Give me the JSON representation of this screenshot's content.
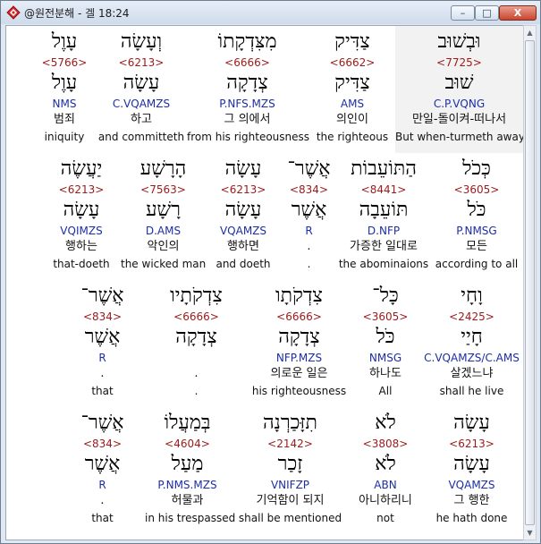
{
  "window": {
    "title": "@원전분해 - 겔 18:24",
    "buttons": {
      "minimize": "–",
      "maximize": "□",
      "close": "X"
    }
  },
  "rows": [
    {
      "cells": [
        {
          "hebrew": "וּבְשׁוּב",
          "strong": "<7725>",
          "lemma": "שׁוּב",
          "parse": "C.P.VQNG",
          "korean": "만일-돌이켜-떠나서",
          "english": "But when-turmeth away",
          "selected": true
        },
        {
          "hebrew": "צַדִּיק",
          "strong": "<6662>",
          "lemma": "צַדִּיק",
          "parse": "AMS",
          "korean": "의인이",
          "english": "the righteous",
          "selected": false
        },
        {
          "hebrew": "מִצִּדְקָתוֹ",
          "strong": "<6666>",
          "lemma": "צְדָקָה",
          "parse": "P.NFS.MZS",
          "korean": "그 의에서",
          "english": "from his righteousness",
          "selected": false
        },
        {
          "hebrew": "וְעָשָׂה",
          "strong": "<6213>",
          "lemma": "עָשָׂה",
          "parse": "C.VQAMZS",
          "korean": "하고",
          "english": "and committeth",
          "selected": false
        },
        {
          "hebrew": "עָוֶל",
          "strong": "<5766>",
          "lemma": "עָוֶל",
          "parse": "NMS",
          "korean": "범죄",
          "english": "iniquity",
          "selected": false
        }
      ]
    },
    {
      "cells": [
        {
          "hebrew": "כְּכֹל",
          "strong": "<3605>",
          "lemma": "כֹּל",
          "parse": "P.NMSG",
          "korean": "모든",
          "english": "according to all",
          "selected": false
        },
        {
          "hebrew": "הַתּוֹעֵבוֹת",
          "strong": "<8441>",
          "lemma": "תּוֹעֵבָה",
          "parse": "D.NFP",
          "korean": "가증한 일대로",
          "english": "the abominaions",
          "selected": false
        },
        {
          "hebrew": "אֲשֶׁר־",
          "strong": "<834>",
          "lemma": "אֲשֶׁר",
          "parse": "R",
          "korean": ".",
          "english": ".",
          "selected": false
        },
        {
          "hebrew": "עָשָׂה",
          "strong": "<6213>",
          "lemma": "עָשָׂה",
          "parse": "VQAMZS",
          "korean": "행하면",
          "english": "and doeth",
          "selected": false
        },
        {
          "hebrew": "הָרָשָׁע",
          "strong": "<7563>",
          "lemma": "רָשָׁע",
          "parse": "D.AMS",
          "korean": "악인의",
          "english": "the wicked man",
          "selected": false
        },
        {
          "hebrew": "יַעֲשֶׂה",
          "strong": "<6213>",
          "lemma": "עָשָׂה",
          "parse": "VQIMZS",
          "korean": "행하는",
          "english": "that-doeth",
          "selected": false
        }
      ]
    },
    {
      "cells": [
        {
          "hebrew": "וָחָי",
          "strong": "<2425>",
          "lemma": "חָיַי",
          "parse": "C.VQAMZS/C.AMS",
          "korean": "살겠느냐",
          "english": "shall he live",
          "selected": false
        },
        {
          "hebrew": "כָּל־",
          "strong": "<3605>",
          "lemma": "כֹּל",
          "parse": "NMSG",
          "korean": "하나도",
          "english": "All",
          "selected": false
        },
        {
          "hebrew": "צִדְקֹתָו",
          "strong": "<6666>",
          "lemma": "צְדָקָה",
          "parse": "NFP.MZS",
          "korean": "의로운 일은",
          "english": "his righteousness",
          "selected": false
        },
        {
          "hebrew": "צִדְקֹתָיו",
          "strong": "<6666>",
          "lemma": "צְדָקָה",
          "parse": "",
          "korean": ".",
          "english": ".",
          "selected": false
        },
        {
          "hebrew": "אֲשֶׁר־",
          "strong": "<834>",
          "lemma": "אֲשֶׁר",
          "parse": "R",
          "korean": ".",
          "english": "that",
          "selected": false
        }
      ]
    },
    {
      "cells": [
        {
          "hebrew": "עָשָׂה",
          "strong": "<6213>",
          "lemma": "עָשָׂה",
          "parse": "VQAMZS",
          "korean": "그 행한",
          "english": "he hath done",
          "selected": false
        },
        {
          "hebrew": "לֹא",
          "strong": "<3808>",
          "lemma": "לֹא",
          "parse": "ABN",
          "korean": "아니하리니",
          "english": "not",
          "selected": false
        },
        {
          "hebrew": "תִזָּכַרְנָה",
          "strong": "<2142>",
          "lemma": "זָכַר",
          "parse": "VNIFZP",
          "korean": "기억함이 되지",
          "english": "shall be mentioned",
          "selected": false
        },
        {
          "hebrew": "בְּמַעֲלוֹ",
          "strong": "<4604>",
          "lemma": "מַעַל",
          "parse": "P.NMS.MZS",
          "korean": "허물과",
          "english": "in his trespassed",
          "selected": false
        },
        {
          "hebrew": "אֲשֶׁר־",
          "strong": "<834>",
          "lemma": "אֲשֶׁר",
          "parse": "R",
          "korean": ".",
          "english": "that",
          "selected": false
        }
      ]
    }
  ]
}
